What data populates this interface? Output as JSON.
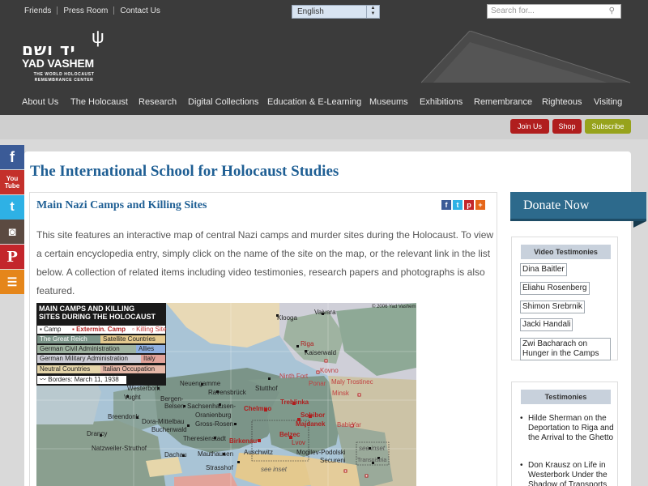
{
  "header": {
    "top_links": [
      "Friends",
      "Press Room",
      "Contact Us"
    ],
    "language": "English",
    "search_placeholder": "Search for...",
    "logo_hebrew": "יד ושם",
    "logo_english": "YAD VASHEM",
    "logo_sub": "THE WORLD HOLOCAUST REMEMBRANCE CENTER"
  },
  "nav": [
    "About Us",
    "The Holocaust",
    "Research",
    "Digital Collections",
    "Education & E-Learning",
    "Museums",
    "Exhibitions",
    "Remembrance",
    "Righteous",
    "Visiting"
  ],
  "strip": {
    "join": "Join Us",
    "shop": "Shop",
    "subscribe": "Subscribe"
  },
  "social": {
    "youtube": "You Tube"
  },
  "page": {
    "school_title": "The International School for Holocaust Studies",
    "content_title": "Main Nazi Camps and Killing Sites",
    "intro": "This site features an interactive map of central Nazi camps and murder sites during the Holocaust. To view a certain encyclopedia entry, simply click on the name of the site on the map, or the relevant link in the list below. A collection of related items including video testimonies, research papers and photographs is also featured."
  },
  "map": {
    "title_line1": "MAIN CAMPS AND KILLING",
    "title_line2": "SITES DURING THE HOLOCAUST",
    "copyright": "© 2006 Yad Vashem",
    "legend": {
      "camp": "Camp",
      "extermination_camp": "Extermin. Camp",
      "killing_site": "Killing Site",
      "reich": "The Great Reich",
      "satellite": "Satellite Countries",
      "civil": "German Civil Administration",
      "allies": "Allies",
      "military": "German Military Administration",
      "italy": "Italy",
      "neutral": "Neutral Countries",
      "italian_occupation": "Italian Occupation",
      "borders": "Borders: March 11, 1938"
    },
    "places": {
      "klooga": "Klooga",
      "vaivara": "Vaivara",
      "riga": "Riga",
      "kaiserwald": "Kaiserwald",
      "kovno": "Kovno",
      "ninth_fort": "Ninth Fort",
      "ponar": "Ponar",
      "maly_trostinec": "Maly Trostinec",
      "minsk": "Minsk",
      "stutthof": "Stutthof",
      "neuengamme": "Neuengamme",
      "westerbork": "Westerbork",
      "vught": "Vught",
      "bergen": "Bergen-",
      "belsen": "Belsen",
      "ravensbruck": "Ravensbrück",
      "sachsenhausen": "Sachsenhausen-",
      "oranienburg": "Oranienburg",
      "chelmno": "Chelmno",
      "treblinka": "Treblinka",
      "sobibor": "Sobibor",
      "majdanek": "Majdanek",
      "babi_yar": "Babi Yar",
      "breendonk": "Breendonk",
      "dora": "Dora-Mittelbau",
      "buchenwald": "Buchenwald",
      "gross_rosen": "Gross-Rosen",
      "belzec": "Belzec",
      "lvov": "Lvov",
      "drancy": "Drancy",
      "theresienstadt": "Theresienstadt",
      "birkenau": "Birkenau",
      "auschwitz": "Auschwitz",
      "natzweiler": "Natzweiler-Struthof",
      "dachau": "Dachau",
      "mauthausen": "Mauthausen",
      "mogilev": "Mogilev-Podolski",
      "strasshof": "Strasshof",
      "see_inset_1": "see inset",
      "see_inset_2": "see inset",
      "transnistria": "Transnistria",
      "secureni": "Secureni"
    }
  },
  "sidebar": {
    "donate": "Donate Now",
    "video_testimonies_heading": "Video Testimonies",
    "video_testimonies": [
      "Dina Baitler",
      "Eliahu Rosenberg",
      "Shimon Srebrnik",
      "Jacki Handali",
      "Zwi Bacharach on Hunger in the Camps"
    ],
    "testimonies_heading": "Testimonies",
    "testimonies": [
      "Hilde Sherman on the Deportation to Riga and the Arrival to the Ghetto",
      "Don Krausz on Life in Westerbork Under the Shadow of Transports"
    ]
  },
  "colors": {
    "header_bg": "#3b3b3b",
    "accent_blue": "#1f5f94",
    "donate_bg": "#2d6a8c",
    "red_button": "#b01e1e",
    "green_button": "#97a31c"
  }
}
